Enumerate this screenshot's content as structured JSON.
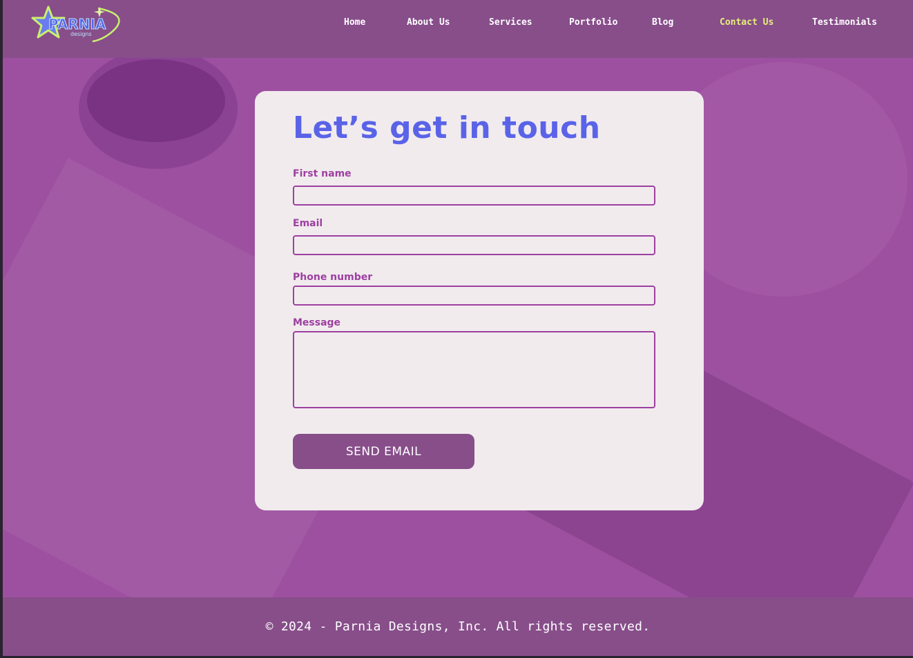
{
  "logo": {
    "text": "PARNIA",
    "subtext": "designs"
  },
  "nav": {
    "items": [
      {
        "label": "Home"
      },
      {
        "label": "About Us"
      },
      {
        "label": "Services"
      },
      {
        "label": "Portfolio"
      },
      {
        "label": "Blog"
      },
      {
        "label": "Contact Us",
        "active": true
      },
      {
        "label": "Testimonials"
      }
    ]
  },
  "form": {
    "title": "Let’s get in touch",
    "fields": {
      "first_name": {
        "label": "First name",
        "value": ""
      },
      "email": {
        "label": "Email",
        "value": ""
      },
      "phone": {
        "label": "Phone number",
        "value": ""
      },
      "message": {
        "label": "Message",
        "value": ""
      }
    },
    "submit_label": "SEND EMAIL"
  },
  "footer": {
    "text": "© 2024 - Parnia Designs, Inc. All rights reserved."
  },
  "colors": {
    "background": "#9d50a0",
    "header": "#874e8a",
    "card": "#f1ebee",
    "title": "#5a63e8",
    "label": "#9d3f9f",
    "active_nav": "#e7ef7c"
  }
}
